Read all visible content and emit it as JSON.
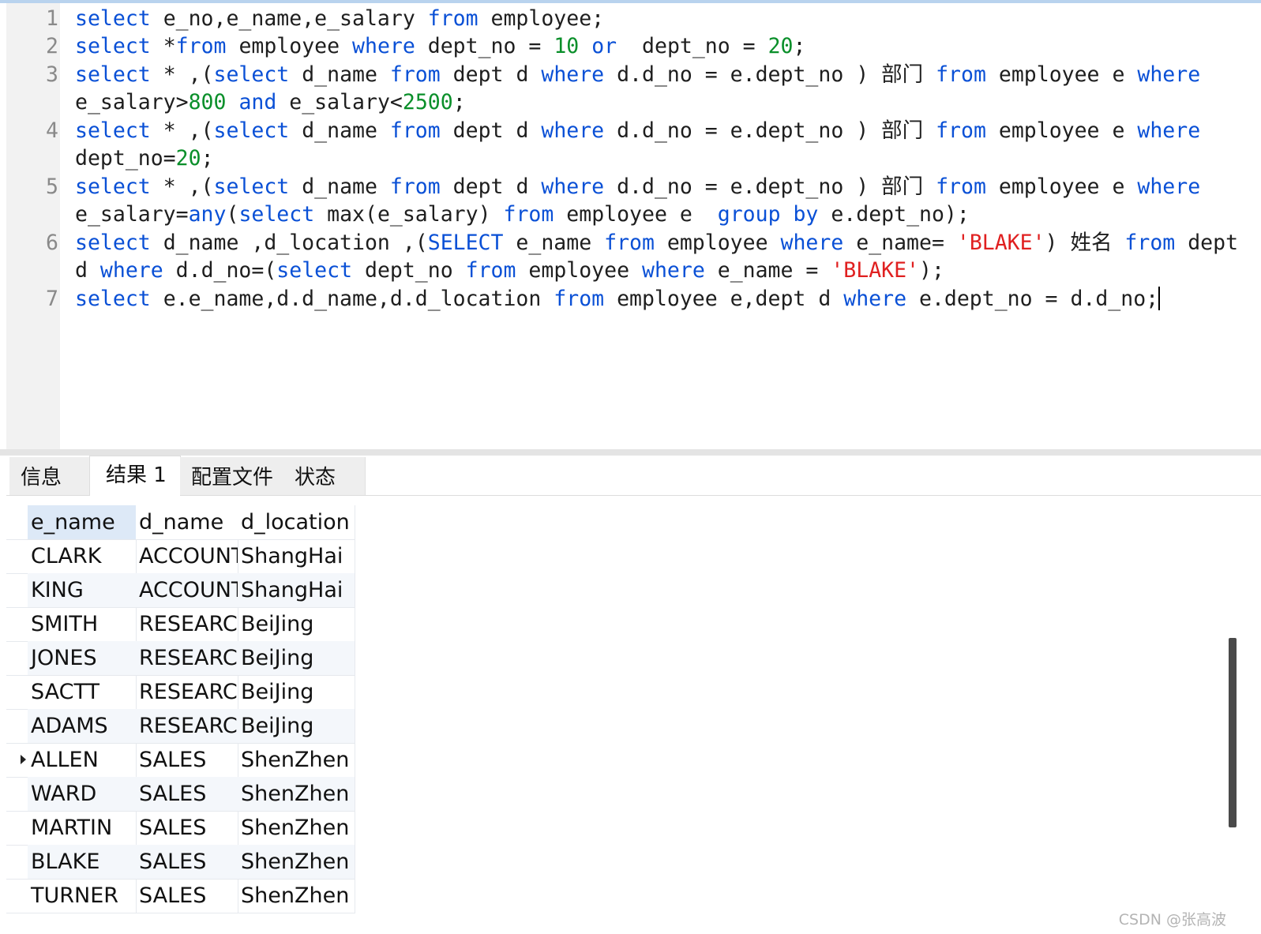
{
  "editor": {
    "lines": [
      {
        "num": "1",
        "tokens": [
          {
            "t": "select",
            "c": "k"
          },
          {
            "t": " e_no,e_name,e_salary ",
            "c": "p"
          },
          {
            "t": "from",
            "c": "k"
          },
          {
            "t": " employee;",
            "c": "p"
          }
        ]
      },
      {
        "num": "2",
        "tokens": [
          {
            "t": "select",
            "c": "k"
          },
          {
            "t": " *",
            "c": "p"
          },
          {
            "t": "from",
            "c": "k"
          },
          {
            "t": " employee ",
            "c": "p"
          },
          {
            "t": "where",
            "c": "k"
          },
          {
            "t": " dept_no = ",
            "c": "p"
          },
          {
            "t": "10",
            "c": "n"
          },
          {
            "t": " ",
            "c": "p"
          },
          {
            "t": "or",
            "c": "k"
          },
          {
            "t": "  dept_no = ",
            "c": "p"
          },
          {
            "t": "20",
            "c": "n"
          },
          {
            "t": ";",
            "c": "p"
          }
        ]
      },
      {
        "num": "3",
        "tokens": [
          {
            "t": "select",
            "c": "k"
          },
          {
            "t": " * ,(",
            "c": "p"
          },
          {
            "t": "select",
            "c": "k"
          },
          {
            "t": " d_name ",
            "c": "p"
          },
          {
            "t": "from",
            "c": "k"
          },
          {
            "t": " dept d ",
            "c": "p"
          },
          {
            "t": "where",
            "c": "k"
          },
          {
            "t": " d.d_no = e.dept_no ) 部门 ",
            "c": "p"
          },
          {
            "t": "from",
            "c": "k"
          },
          {
            "t": " employee e ",
            "c": "p"
          },
          {
            "t": "where",
            "c": "k"
          }
        ]
      },
      {
        "num": "",
        "tokens": [
          {
            "t": "e_salary>",
            "c": "p"
          },
          {
            "t": "800",
            "c": "n"
          },
          {
            "t": " ",
            "c": "p"
          },
          {
            "t": "and",
            "c": "k"
          },
          {
            "t": " e_salary<",
            "c": "p"
          },
          {
            "t": "2500",
            "c": "n"
          },
          {
            "t": ";",
            "c": "p"
          }
        ]
      },
      {
        "num": "4",
        "tokens": [
          {
            "t": "select",
            "c": "k"
          },
          {
            "t": " * ,(",
            "c": "p"
          },
          {
            "t": "select",
            "c": "k"
          },
          {
            "t": " d_name ",
            "c": "p"
          },
          {
            "t": "from",
            "c": "k"
          },
          {
            "t": " dept d ",
            "c": "p"
          },
          {
            "t": "where",
            "c": "k"
          },
          {
            "t": " d.d_no = e.dept_no ) 部门 ",
            "c": "p"
          },
          {
            "t": "from",
            "c": "k"
          },
          {
            "t": " employee e ",
            "c": "p"
          },
          {
            "t": "where",
            "c": "k"
          }
        ]
      },
      {
        "num": "",
        "tokens": [
          {
            "t": "dept_no=",
            "c": "p"
          },
          {
            "t": "20",
            "c": "n"
          },
          {
            "t": ";",
            "c": "p"
          }
        ]
      },
      {
        "num": "5",
        "tokens": [
          {
            "t": "select",
            "c": "k"
          },
          {
            "t": " * ,(",
            "c": "p"
          },
          {
            "t": "select",
            "c": "k"
          },
          {
            "t": " d_name ",
            "c": "p"
          },
          {
            "t": "from",
            "c": "k"
          },
          {
            "t": " dept d ",
            "c": "p"
          },
          {
            "t": "where",
            "c": "k"
          },
          {
            "t": " d.d_no = e.dept_no ) 部门 ",
            "c": "p"
          },
          {
            "t": "from",
            "c": "k"
          },
          {
            "t": " employee e ",
            "c": "p"
          },
          {
            "t": "where",
            "c": "k"
          }
        ]
      },
      {
        "num": "",
        "tokens": [
          {
            "t": "e_salary=",
            "c": "p"
          },
          {
            "t": "any",
            "c": "k"
          },
          {
            "t": "(",
            "c": "p"
          },
          {
            "t": "select",
            "c": "k"
          },
          {
            "t": " max(e_salary) ",
            "c": "p"
          },
          {
            "t": "from",
            "c": "k"
          },
          {
            "t": " employee e  ",
            "c": "p"
          },
          {
            "t": "group by",
            "c": "k"
          },
          {
            "t": " e.dept_no);",
            "c": "p"
          }
        ]
      },
      {
        "num": "6",
        "tokens": [
          {
            "t": "select",
            "c": "k"
          },
          {
            "t": " d_name ,d_location ,(",
            "c": "p"
          },
          {
            "t": "SELECT",
            "c": "k"
          },
          {
            "t": " e_name ",
            "c": "p"
          },
          {
            "t": "from",
            "c": "k"
          },
          {
            "t": " employee ",
            "c": "p"
          },
          {
            "t": "where",
            "c": "k"
          },
          {
            "t": " e_name= ",
            "c": "p"
          },
          {
            "t": "'BLAKE'",
            "c": "s"
          },
          {
            "t": ") 姓名 ",
            "c": "p"
          },
          {
            "t": "from",
            "c": "k"
          },
          {
            "t": " dept",
            "c": "p"
          }
        ]
      },
      {
        "num": "",
        "tokens": [
          {
            "t": "d ",
            "c": "p"
          },
          {
            "t": "where",
            "c": "k"
          },
          {
            "t": " d.d_no=(",
            "c": "p"
          },
          {
            "t": "select",
            "c": "k"
          },
          {
            "t": " dept_no ",
            "c": "p"
          },
          {
            "t": "from",
            "c": "k"
          },
          {
            "t": " employee ",
            "c": "p"
          },
          {
            "t": "where",
            "c": "k"
          },
          {
            "t": " e_name = ",
            "c": "p"
          },
          {
            "t": "'BLAKE'",
            "c": "s"
          },
          {
            "t": ");",
            "c": "p"
          }
        ]
      },
      {
        "num": "7",
        "tokens": [
          {
            "t": "select",
            "c": "k"
          },
          {
            "t": " e.e_name,d.d_name,d.d_location ",
            "c": "p"
          },
          {
            "t": "from",
            "c": "k"
          },
          {
            "t": " employee e,dept d ",
            "c": "p"
          },
          {
            "t": "where",
            "c": "k"
          },
          {
            "t": " e.dept_no = d.d_no;",
            "c": "p"
          }
        ]
      }
    ],
    "caret_line_index": 10
  },
  "tabs": [
    {
      "label": "信息",
      "active": false
    },
    {
      "label": "结果 1",
      "active": true
    },
    {
      "label": "配置文件",
      "active": false
    },
    {
      "label": "状态",
      "active": false
    }
  ],
  "result": {
    "columns": [
      "e_name",
      "d_name",
      "d_location"
    ],
    "rows": [
      [
        "CLARK",
        "ACCOUNTING",
        "ShangHai"
      ],
      [
        "KING",
        "ACCOUNTING",
        "ShangHai"
      ],
      [
        "SMITH",
        "RESEARCH",
        "BeiJing"
      ],
      [
        "JONES",
        "RESEARCH",
        "BeiJing"
      ],
      [
        "SACTT",
        "RESEARCH",
        "BeiJing"
      ],
      [
        "ADAMS",
        "RESEARCH",
        "BeiJing"
      ],
      [
        "ALLEN",
        "SALES",
        "ShenZhen"
      ],
      [
        "WARD",
        "SALES",
        "ShenZhen"
      ],
      [
        "MARTIN",
        "SALES",
        "ShenZhen"
      ],
      [
        "BLAKE",
        "SALES",
        "ShenZhen"
      ],
      [
        "TURNER",
        "SALES",
        "ShenZhen"
      ]
    ],
    "current_row_index": 6
  },
  "watermark": "CSDN @张高波",
  "colors": {
    "keyword": "#0a50d6",
    "number": "#0a8f2a",
    "string": "#e02020",
    "header_selected": "#dde9f7"
  }
}
